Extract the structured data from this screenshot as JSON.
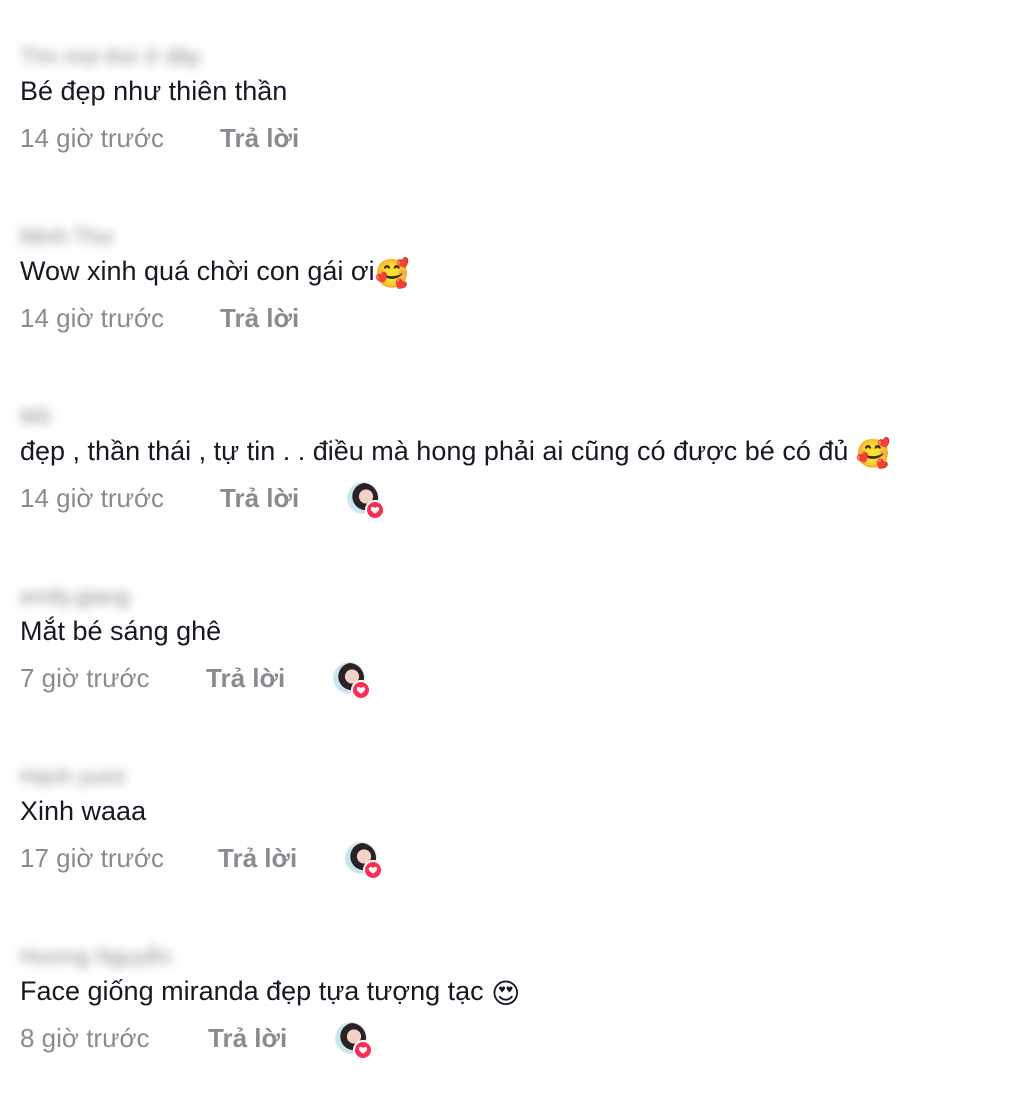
{
  "comments": [
    {
      "username": "Tìm mọi thứ ở đây",
      "text": "Bé đẹp như thiên thần",
      "emoji": "",
      "time": "14 giờ trước",
      "reply": "Trả lời",
      "liked_by_creator": false
    },
    {
      "username": "Minh Thư",
      "text": "Wow xinh quá chời con gái ơi",
      "emoji": "🥰",
      "time": "14 giờ trước",
      "reply": "Trả lời",
      "liked_by_creator": false
    },
    {
      "username": "Mít",
      "text": "đẹp , thần thái , tự tin . . điều mà hong phải ai cũng có được bé có đủ ",
      "emoji": "🥰",
      "time": "14 giờ trước",
      "reply": "Trả lời",
      "liked_by_creator": true
    },
    {
      "username": "emily.giang",
      "text": "Mắt bé sáng ghê",
      "emoji": "",
      "time": "7 giờ trước",
      "reply": "Trả lời",
      "liked_by_creator": true
    },
    {
      "username": "Hạnh yumi",
      "text": "Xinh waaa",
      "emoji": "",
      "time": "17 giờ trước",
      "reply": "Trả lời",
      "liked_by_creator": true
    },
    {
      "username": "Hương Nguyễn",
      "text": "Face giống miranda đẹp tựa tượng tạc ",
      "emoji": "😍",
      "time": "8 giờ trước",
      "reply": "Trả lời",
      "liked_by_creator": true
    }
  ],
  "icons": {
    "liked_badge": "heart-icon",
    "liked_avatar": "creator-avatar"
  },
  "colors": {
    "text": "#161823",
    "secondary": "#8a8b91",
    "heart": "#fe2c55"
  }
}
